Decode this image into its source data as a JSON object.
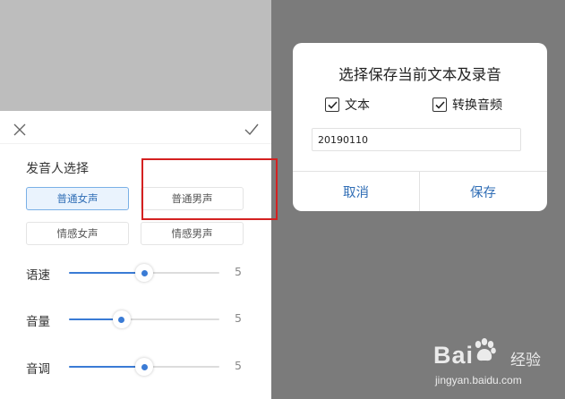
{
  "left_panel": {
    "section_title": "发音人选择",
    "voices": [
      {
        "label": "普通女声",
        "selected": true
      },
      {
        "label": "普通男声",
        "selected": false
      },
      {
        "label": "情感女声",
        "selected": false
      },
      {
        "label": "情感男声",
        "selected": false
      }
    ],
    "sliders": [
      {
        "label": "语速",
        "value": "5",
        "level_fraction": 0.5
      },
      {
        "label": "音量",
        "value": "5",
        "level_fraction": 0.35
      },
      {
        "label": "音调",
        "value": "5",
        "level_fraction": 0.5
      }
    ],
    "icons": {
      "close": "close-icon",
      "confirm": "check-icon"
    }
  },
  "dialog": {
    "title": "选择保存当前文本及录音",
    "options": [
      {
        "label": "文本",
        "checked": true
      },
      {
        "label": "转换音频",
        "checked": true
      }
    ],
    "filename_value": "20190110",
    "cancel_label": "取消",
    "save_label": "保存"
  },
  "colors": {
    "accent": "#2f6db5",
    "slider": "#3a7bd5",
    "overlay": "#7b7b7b",
    "highlight": "#d42121"
  },
  "watermark": {
    "brand": "Bai",
    "brand_suffix": "经验",
    "url": "jingyan.baidu.com"
  }
}
